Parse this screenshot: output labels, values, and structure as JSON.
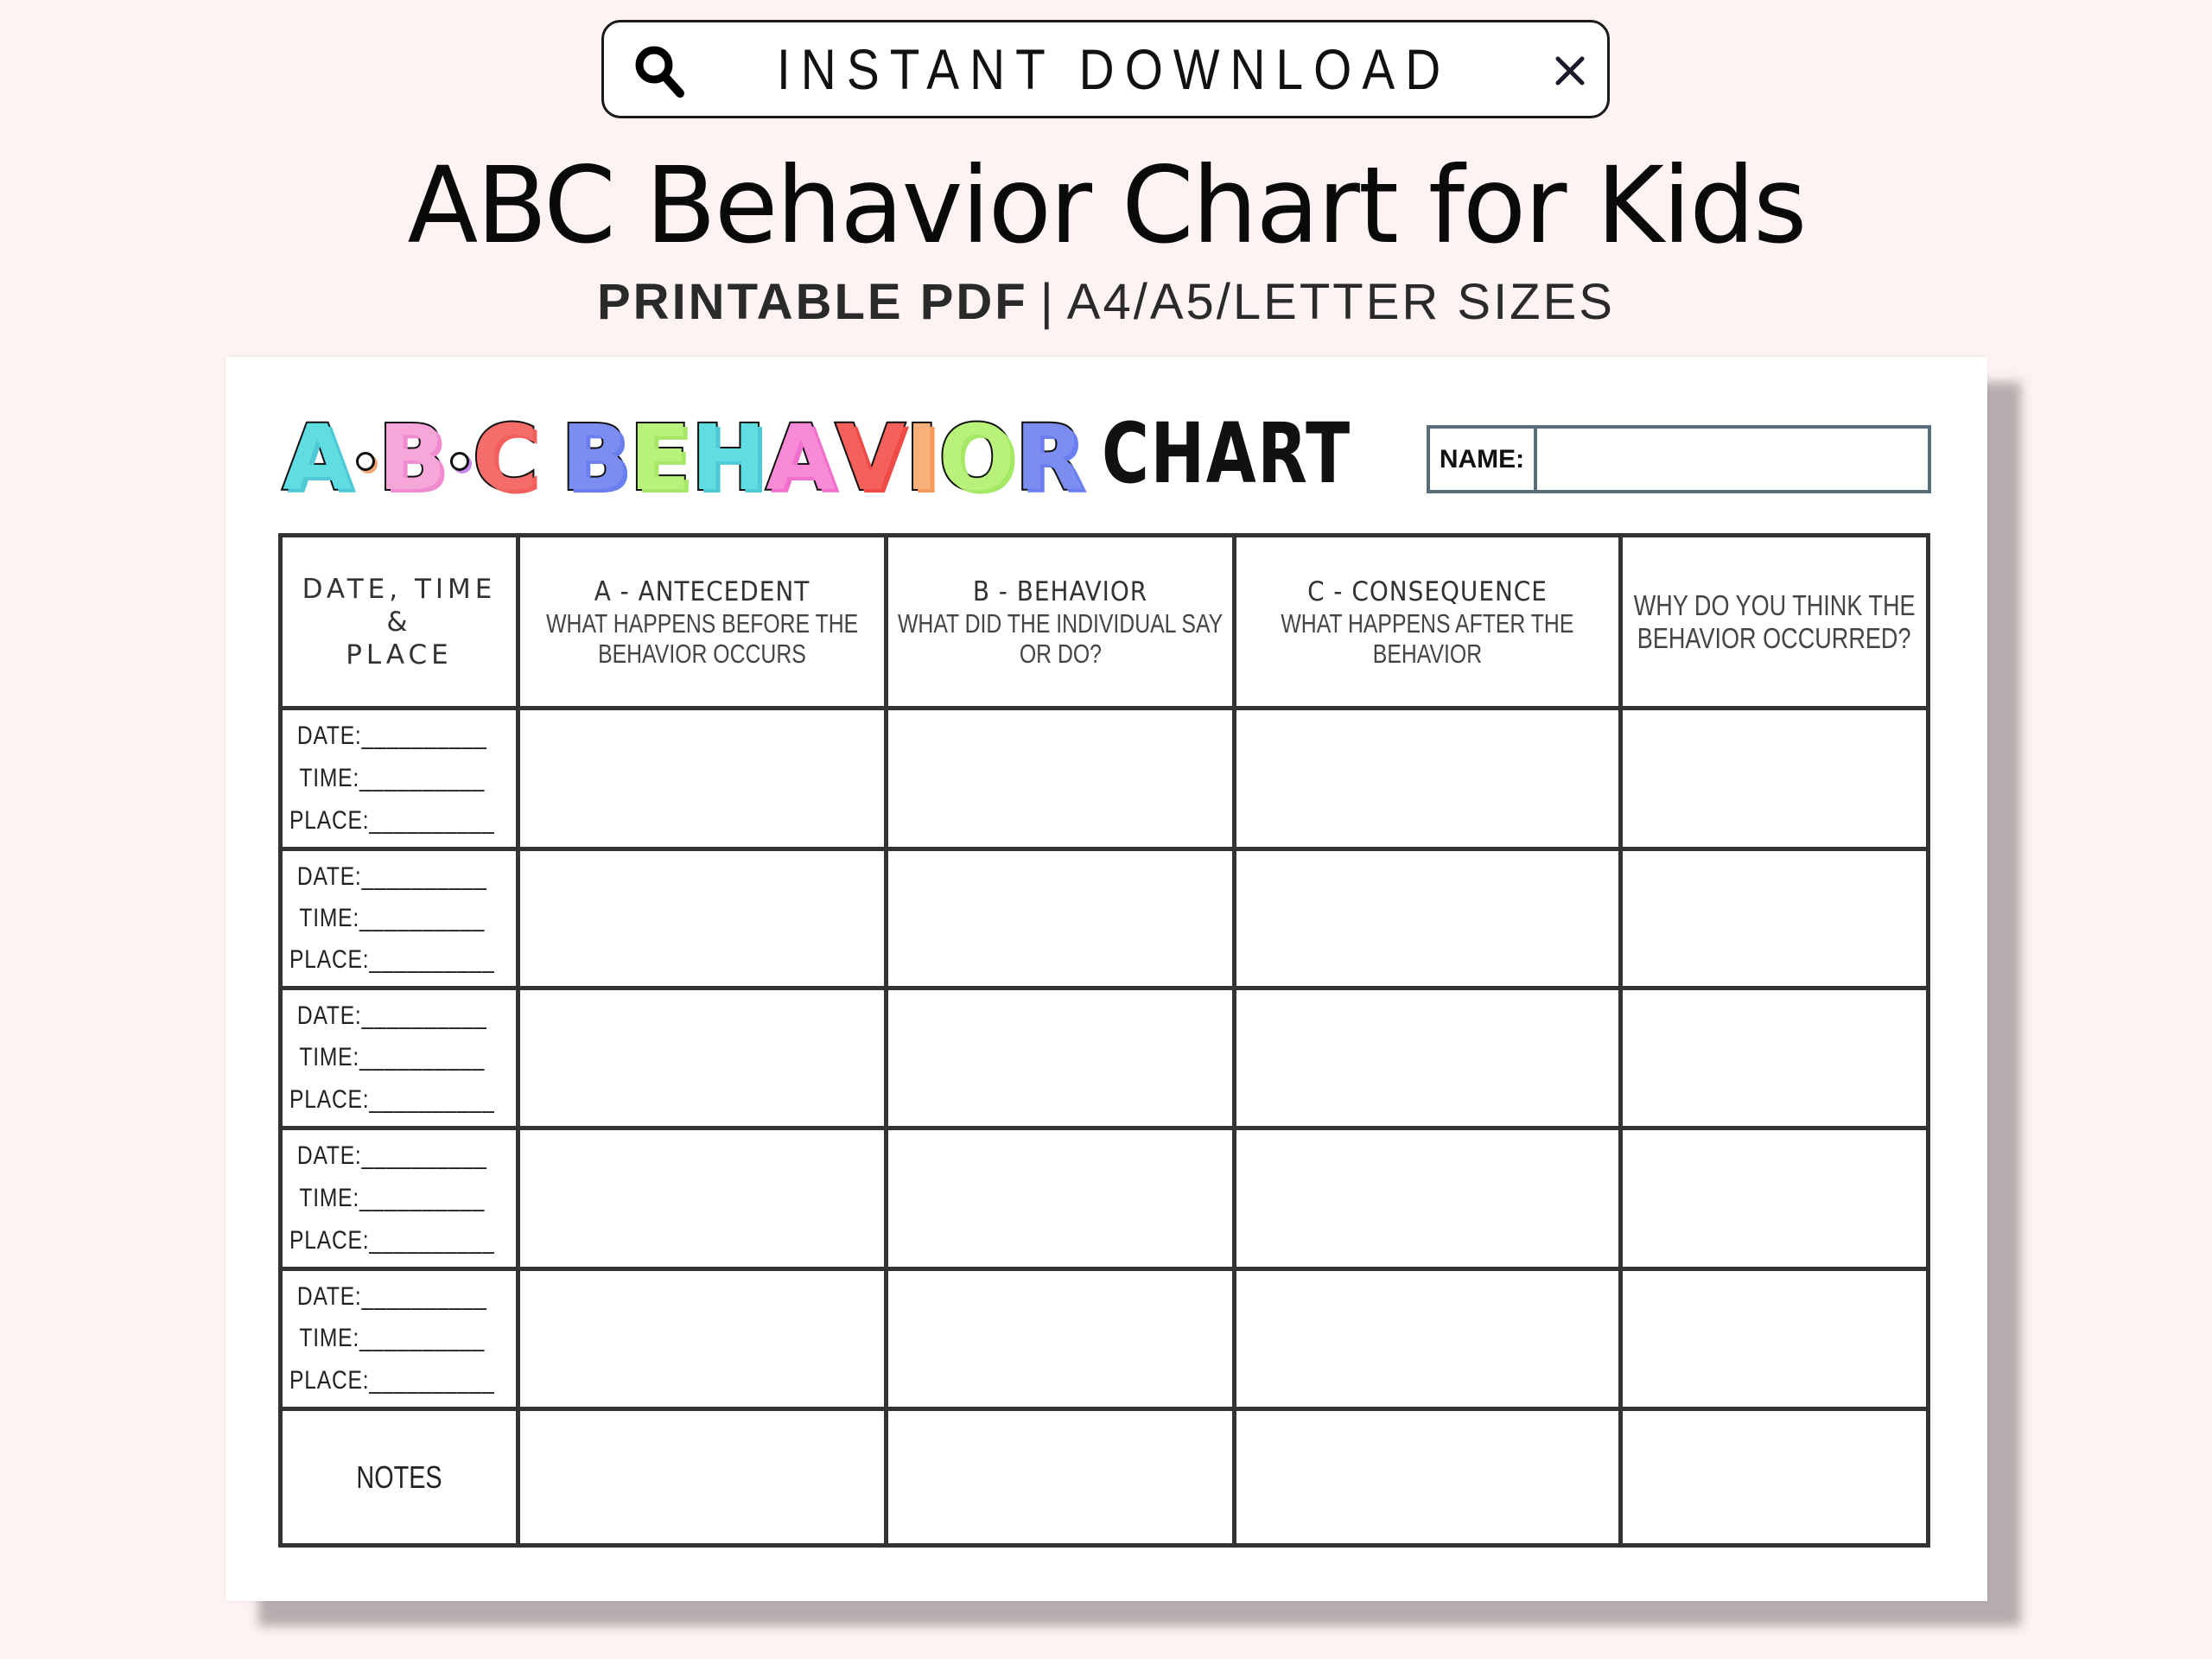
{
  "search_bar": {
    "icon": "search-icon",
    "text": "INSTANT DOWNLOAD",
    "close_icon": "close-icon"
  },
  "header": {
    "title": "ABC Behavior Chart for Kids",
    "subtitle_bold": "PRINTABLE PDF",
    "subtitle_separator": "|",
    "subtitle_rest": "A4/A5/LETTER SIZES"
  },
  "worksheet": {
    "logo": {
      "letters": [
        {
          "char": "A",
          "color": "#5fdde0",
          "shadow": "#4fc9d6"
        },
        {
          "dot": true,
          "shadow": "#f4a574"
        },
        {
          "char": "B",
          "color": "#f7a6d9",
          "shadow": "#f08bd0"
        },
        {
          "dot": true,
          "shadow": "#c98bf0"
        },
        {
          "char": "C",
          "color": "#f46d6a",
          "shadow": "#f2605c"
        },
        {
          "gap": true
        },
        {
          "char": "B",
          "color": "#7b8ef0",
          "shadow": "#6a7ef0"
        },
        {
          "char": "E",
          "color": "#b9f27a",
          "shadow": "#a4e866"
        },
        {
          "char": "H",
          "color": "#5fdde0",
          "shadow": "#4fc9d6"
        },
        {
          "char": "A",
          "color": "#f78bd6",
          "shadow": "#f070cc"
        },
        {
          "char": "V",
          "color": "#f4605c",
          "shadow": "#f04a46"
        },
        {
          "char": "I",
          "color": "#f7b07a",
          "shadow": "#f49a5c"
        },
        {
          "char": "O",
          "color": "#b9f27a",
          "shadow": "#a4e866"
        },
        {
          "char": "R",
          "color": "#7b8ef0",
          "shadow": "#6a7ef0"
        }
      ],
      "chart_word": "CHART"
    },
    "name_label": "NAME:",
    "name_value": "",
    "columns": [
      {
        "title": "DATE, TIME &",
        "title2": "PLACE",
        "subtitle": []
      },
      {
        "title": "A - ANTECEDENT",
        "subtitle": [
          "WHAT HAPPENS BEFORE THE",
          "BEHAVIOR OCCURS"
        ]
      },
      {
        "title": "B - BEHAVIOR",
        "subtitle": [
          "WHAT DID THE INDIVIDUAL SAY",
          "OR DO?"
        ]
      },
      {
        "title": "C -  CONSEQUENCE",
        "subtitle": [
          "WHAT HAPPENS AFTER THE",
          "BEHAVIOR"
        ]
      },
      {
        "title": "",
        "subtitle": [
          "WHY DO YOU THINK THE",
          "BEHAVIOR OCCURRED?"
        ]
      }
    ],
    "entry_rows": [
      {
        "date": "DATE:__________",
        "time": "TIME:__________",
        "place": "PLACE:__________"
      },
      {
        "date": "DATE:__________",
        "time": "TIME:__________",
        "place": "PLACE:__________"
      },
      {
        "date": "DATE:__________",
        "time": "TIME:__________",
        "place": "PLACE:__________"
      },
      {
        "date": "DATE:__________",
        "time": "TIME:__________",
        "place": "PLACE:__________"
      },
      {
        "date": "DATE:__________",
        "time": "TIME:__________",
        "place": "PLACE:__________"
      }
    ],
    "notes_label": "NOTES"
  },
  "colors": {
    "background": "#fdf3f2",
    "grid_lines": "#333333",
    "name_box_border": "#5a6b78",
    "card_shadow": "#b5adad"
  }
}
